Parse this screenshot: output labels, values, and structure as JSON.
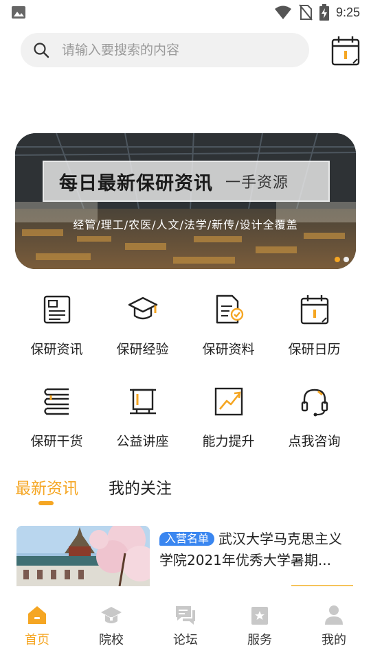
{
  "status_bar": {
    "time": "9:25",
    "icons": [
      "image-icon",
      "wifi-icon",
      "no-sim-icon",
      "battery-charging-icon"
    ]
  },
  "search": {
    "placeholder": "请输入要搜索的内容",
    "value": ""
  },
  "banner": {
    "title": "每日最新保研资讯",
    "subtitle": "一手资源",
    "tags": "经管/理工/农医/人文/法学/新传/设计全覆盖",
    "page_count": 2,
    "active_page": 1
  },
  "grid": {
    "items": [
      {
        "label": "保研资讯",
        "icon": "news-icon"
      },
      {
        "label": "保研经验",
        "icon": "graduation-cap-icon"
      },
      {
        "label": "保研资料",
        "icon": "document-check-icon"
      },
      {
        "label": "保研日历",
        "icon": "calendar-icon"
      },
      {
        "label": "保研干货",
        "icon": "books-icon"
      },
      {
        "label": "公益讲座",
        "icon": "podium-icon"
      },
      {
        "label": "能力提升",
        "icon": "growth-chart-icon"
      },
      {
        "label": "点我咨询",
        "icon": "headset-icon"
      }
    ]
  },
  "tabs": [
    {
      "label": "最新资讯",
      "active": true
    },
    {
      "label": "我的关注",
      "active": false
    }
  ],
  "article": {
    "tag": "入营名单",
    "title": "武汉大学马克思主义学院2021年优秀大学暑期..."
  },
  "bottom_nav": [
    {
      "label": "首页",
      "icon": "home-icon",
      "active": true
    },
    {
      "label": "院校",
      "icon": "school-icon",
      "active": false
    },
    {
      "label": "论坛",
      "icon": "forum-icon",
      "active": false
    },
    {
      "label": "服务",
      "icon": "service-icon",
      "active": false
    },
    {
      "label": "我的",
      "icon": "user-icon",
      "active": false
    }
  ],
  "colors": {
    "accent": "#f5a623",
    "tag_blue": "#3a86f0",
    "search_bg": "#f1f1f1"
  }
}
